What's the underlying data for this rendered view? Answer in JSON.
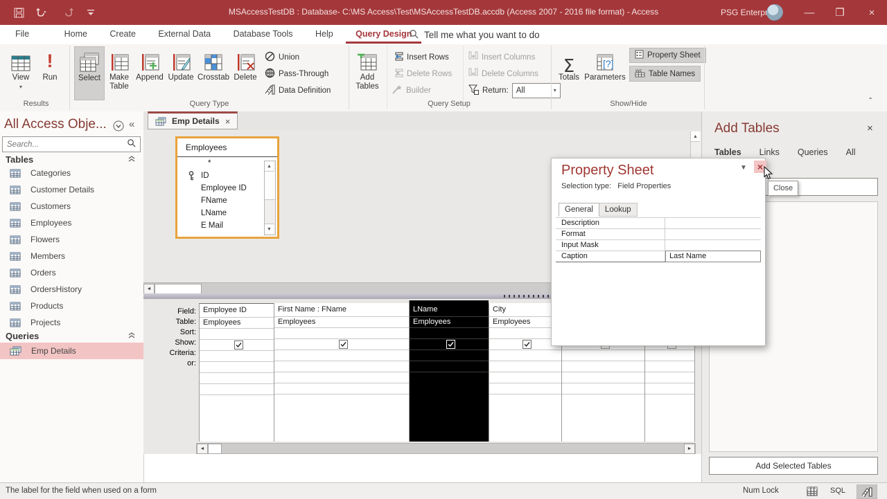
{
  "titlebar": {
    "title": "MSAccessTestDB : Database- C:\\MS Access\\Test\\MSAccessTestDB.accdb (Access 2007 - 2016 file format)  -  Access",
    "account": "PSG Enterprises"
  },
  "ribbon_tabs": {
    "file": "File",
    "home": "Home",
    "create": "Create",
    "external_data": "External Data",
    "database_tools": "Database Tools",
    "help": "Help",
    "query_design": "Query Design",
    "tell_me": "Tell me what you want to do"
  },
  "ribbon": {
    "view": "View",
    "run": "Run",
    "results_label": "Results",
    "select": "Select",
    "make_table": "Make Table",
    "append": "Append",
    "update": "Update",
    "crosstab": "Crosstab",
    "delete": "Delete",
    "union": "Union",
    "pass_through": "Pass-Through",
    "data_definition": "Data Definition",
    "query_type_label": "Query Type",
    "add_tables": "Add Tables",
    "insert_rows": "Insert Rows",
    "delete_rows": "Delete Rows",
    "builder": "Builder",
    "insert_columns": "Insert Columns",
    "delete_columns": "Delete Columns",
    "return_label": "Return:",
    "return_value": "All",
    "query_setup_label": "Query Setup",
    "totals": "Totals",
    "parameters": "Parameters",
    "property_sheet": "Property Sheet",
    "table_names": "Table Names",
    "show_hide_label": "Show/Hide"
  },
  "sidebar": {
    "title": "All Access Obje...",
    "search_placeholder": "Search...",
    "tables_header": "Tables",
    "tables": [
      "Categories",
      "Customer Details",
      "Customers",
      "Employees",
      "Flowers",
      "Members",
      "Orders",
      "OrdersHistory",
      "Products",
      "Projects"
    ],
    "queries_header": "Queries",
    "queries": [
      "Emp Details"
    ]
  },
  "document": {
    "tab_label": "Emp Details",
    "table_box": {
      "title": "Employees",
      "fields": [
        "*",
        "ID",
        "Employee ID",
        "FName",
        "LName",
        "E Mail"
      ]
    }
  },
  "grid": {
    "row_labels": [
      "Field:",
      "Table:",
      "Sort:",
      "Show:",
      "Criteria:",
      "or:"
    ],
    "columns": [
      {
        "field": "Employee ID",
        "table": "Employees"
      },
      {
        "field": "First Name : FName",
        "table": "Employees"
      },
      {
        "field": "LName",
        "table": "Employees"
      },
      {
        "field": "City",
        "table": "Employees"
      }
    ]
  },
  "property_sheet": {
    "title": "Property Sheet",
    "selection_label": "Selection type:",
    "selection_value": "Field Properties",
    "tab_general": "General",
    "tab_lookup": "Lookup",
    "rows": [
      {
        "name": "Description",
        "value": ""
      },
      {
        "name": "Format",
        "value": ""
      },
      {
        "name": "Input Mask",
        "value": ""
      },
      {
        "name": "Caption",
        "value": "Last Name"
      }
    ],
    "close_tooltip": "Close"
  },
  "add_tables_panel": {
    "title": "Add Tables",
    "tab_tables": "Tables",
    "tab_links": "Links",
    "tab_queries": "Queries",
    "tab_all": "All",
    "add_button": "Add Selected Tables"
  },
  "statusbar": {
    "message": "The label for the field when used on a form",
    "num_lock": "Num Lock",
    "sql": "SQL"
  }
}
